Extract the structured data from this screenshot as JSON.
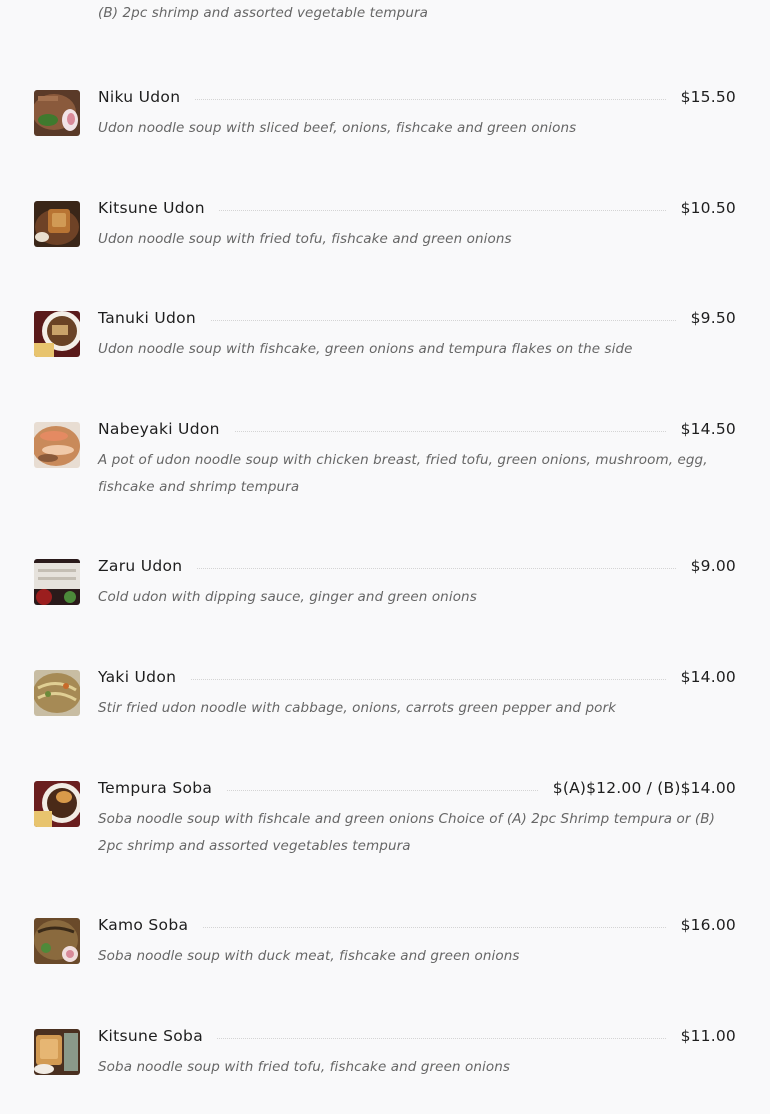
{
  "top_description": "(B) 2pc shrimp and assorted vegetable tempura",
  "items": [
    {
      "name": "Niku Udon",
      "price": "$15.50",
      "description": "Udon noodle soup with sliced beef, onions, fishcake and green onions"
    },
    {
      "name": "Kitsune Udon",
      "price": "$10.50",
      "description": "Udon noodle soup with fried tofu, fishcake and green onions"
    },
    {
      "name": "Tanuki Udon",
      "price": "$9.50",
      "description": "Udon noodle soup with fishcake, green onions and tempura flakes on the side"
    },
    {
      "name": "Nabeyaki Udon",
      "price": "$14.50",
      "description": "A pot of udon noodle soup with chicken breast, fried tofu, green onions, mushroom, egg, fishcake and shrimp tempura"
    },
    {
      "name": "Zaru Udon",
      "price": "$9.00",
      "description": "Cold udon with dipping sauce, ginger and green onions"
    },
    {
      "name": "Yaki Udon",
      "price": "$14.00",
      "description": "Stir fried udon noodle with cabbage, onions, carrots green pepper and pork"
    },
    {
      "name": "Tempura Soba",
      "price": "$(A)$12.00 / (B)$14.00",
      "description": "Soba noodle soup with fishcale and green onions Choice of (A) 2pc Shrimp tempura or (B) 2pc shrimp and assorted vegetables tempura"
    },
    {
      "name": "Kamo Soba",
      "price": "$16.00",
      "description": "Soba noodle soup with duck meat, fishcake and green onions"
    },
    {
      "name": "Kitsune Soba",
      "price": "$11.00",
      "description": "Soba noodle soup with fried tofu, fishcake and green onions"
    }
  ]
}
